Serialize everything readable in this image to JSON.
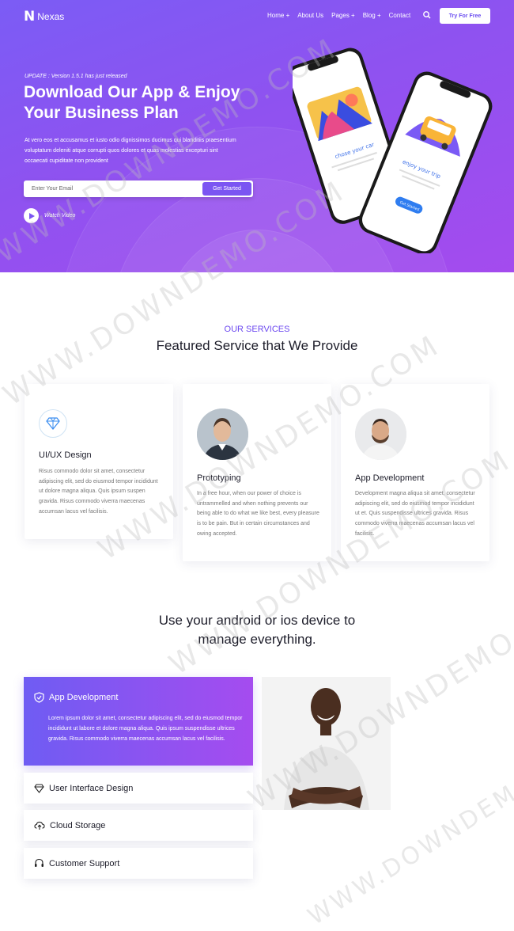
{
  "header": {
    "logo_mark": "N",
    "logo_text": "Nexas",
    "nav": [
      "Home +",
      "About Us",
      "Pages +",
      "Blog +",
      "Contact"
    ],
    "cta": "Try For Free"
  },
  "hero": {
    "update": "UPDATE : Version 1.5.1 has just released",
    "title": "Download Our App & Enjoy Your Business Plan",
    "paragraph": "At vero eos et accusamus et iusto odio dignissimos ducimus qui blanditiis praesentium voluptatum deleniti atque corrupti quos dolores et quas molestias excepturi sint occaecati cupiditate non provident",
    "email_placeholder": "Enter Your Email",
    "get_started": "Get Started",
    "watch_video": "Watch Video",
    "phone1_text": "chose your car",
    "phone2_text": "enjoy your trip",
    "phone2_button": "Get Started"
  },
  "services": {
    "eyebrow": "OUR SERVICES",
    "title": "Featured Service that We Provide",
    "cards": [
      {
        "title": "UI/UX Design",
        "text": "Risus commodo dolor sit amet, consectetur adipiscing elit, sed do eiusmod tempor incididunt ut dolore magna aliqua. Quis ipsum suspen gravida. Risus commodo viverra maecenas accumsan lacus vel facilisis."
      },
      {
        "title": "Prototyping",
        "text": "In a free hour, when our power of choice is untrammelled and when nothing prevents our being able to do what we like best, every pleasure is to be pain. But in certain circumstances and owing accepted."
      },
      {
        "title": "App Development",
        "text": "Development magna aliqua sit amet, consectetur adipiscing elit, sed do eiusmod tempor incididunt ut et. Quis suspendisse ultrices gravida. Risus commodo viverra maecenas accumsan lacus vel facilisis."
      }
    ]
  },
  "features": {
    "title": "Use your android or ios device to manage everything.",
    "active": {
      "title": "App Development",
      "text": "Lorem ipsum dolor sit amet, consectetur adipiscing elit, sed do eiusmod tempor incididunt ut labore et dolore magna aliqua. Quis ipsum suspendisse ultrices gravida. Risus commodo viverra maecenas accumsan lacus vel facilisis."
    },
    "items": [
      "User Interface Design",
      "Cloud Storage",
      "Customer Support"
    ]
  },
  "watermark": "WWW.DOWNDEMO.COM",
  "colors": {
    "accent": "#7b55f2",
    "hero_start": "#7b5cf5",
    "hero_end": "#a44bee"
  }
}
